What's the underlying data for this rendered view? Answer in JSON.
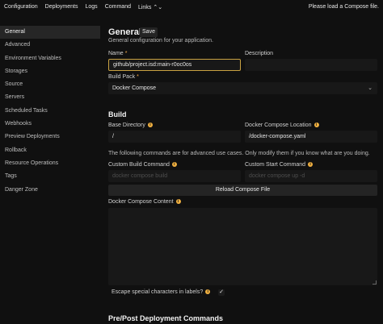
{
  "topnav": {
    "items": [
      "Configuration",
      "Deployments",
      "Logs",
      "Command",
      "Links"
    ],
    "status": "Please load a Compose file."
  },
  "sidebar": {
    "items": [
      "General",
      "Advanced",
      "Environment Variables",
      "Storages",
      "Source",
      "Servers",
      "Scheduled Tasks",
      "Webhooks",
      "Preview Deployments",
      "Rollback",
      "Resource Operations",
      "Tags",
      "Danger Zone"
    ],
    "active": "General"
  },
  "general": {
    "title": "General",
    "save_label": "Save",
    "subtitle": "General configuration for your application.",
    "name_label": "Name",
    "name_value": "github/project.isd:main-r0oc0os",
    "description_label": "Description",
    "description_value": "",
    "build_pack_label": "Build Pack",
    "build_pack_value": "Docker Compose"
  },
  "build": {
    "title": "Build",
    "base_directory_label": "Base Directory",
    "base_directory_value": "/",
    "compose_location_label": "Docker Compose Location",
    "compose_location_value": "/docker-compose.yaml",
    "advanced_note": "The following commands are for advanced use cases. Only modify them if you know what are you doing.",
    "custom_build_label": "Custom Build Command",
    "custom_build_placeholder": "docker compose build",
    "custom_start_label": "Custom Start Command",
    "custom_start_placeholder": "docker compose up -d",
    "reload_label": "Reload Compose File",
    "compose_content_label": "Docker Compose Content",
    "escape_label": "Escape special characters in labels?",
    "escape_checked": true
  },
  "prepost": {
    "title": "Pre/Post Deployment Commands"
  },
  "colors": {
    "background": "#101010",
    "input": "#181818",
    "accent": "#f0b040"
  }
}
